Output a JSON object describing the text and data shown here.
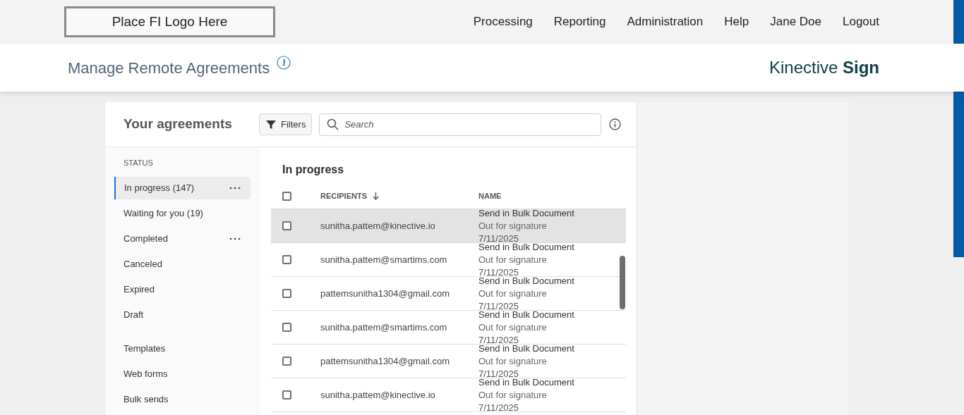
{
  "header": {
    "logo": "Place FI Logo Here",
    "nav": [
      "Processing",
      "Reporting",
      "Administration",
      "Help",
      "Jane Doe",
      "Logout"
    ]
  },
  "page": {
    "title": "Manage Remote Agreements",
    "brand_light": "Kinective",
    "brand_bold": "Sign"
  },
  "panel": {
    "title": "Your agreements",
    "filters_button": "Filters",
    "search": {
      "placeholder": "Search"
    }
  },
  "sidebar": {
    "section": "STATUS",
    "groups": [
      {
        "items": [
          {
            "label": "In progress (147)",
            "selected": true,
            "menu": true
          },
          {
            "label": "Waiting for you (19)",
            "selected": false,
            "menu": false
          },
          {
            "label": "Completed",
            "selected": false,
            "menu": true
          },
          {
            "label": "Canceled",
            "selected": false,
            "menu": false
          },
          {
            "label": "Expired",
            "selected": false,
            "menu": false
          },
          {
            "label": "Draft",
            "selected": false,
            "menu": false
          }
        ]
      },
      {
        "items": [
          {
            "label": "Templates",
            "selected": false,
            "menu": false
          },
          {
            "label": "Web forms",
            "selected": false,
            "menu": false
          },
          {
            "label": "Bulk sends",
            "selected": false,
            "menu": false
          }
        ]
      }
    ]
  },
  "list": {
    "title": "In progress",
    "select_all_checked": false,
    "columns": [
      "RECIPIENTS",
      "NAME"
    ],
    "rows": [
      {
        "recipient": "sunitha.pattem@kinective.io",
        "name": "Send in Bulk Document",
        "status": "Out for signature",
        "date": "7/11/2025",
        "checked": false,
        "highlighted": true
      },
      {
        "recipient": "sunitha.pattem@smartims.com",
        "name": "Send in Bulk Document",
        "status": "Out for signature",
        "date": "7/11/2025",
        "checked": false,
        "highlighted": false
      },
      {
        "recipient": "pattemsunitha1304@gmail.com",
        "name": "Send in Bulk Document",
        "status": "Out for signature",
        "date": "7/11/2025",
        "checked": false,
        "highlighted": false
      },
      {
        "recipient": "sunitha.pattem@smartims.com",
        "name": "Send in Bulk Document",
        "status": "Out for signature",
        "date": "7/11/2025",
        "checked": false,
        "highlighted": false
      },
      {
        "recipient": "pattemsunitha1304@gmail.com",
        "name": "Send in Bulk Document",
        "status": "Out for signature",
        "date": "7/11/2025",
        "checked": false,
        "highlighted": false
      },
      {
        "recipient": "sunitha.pattem@kinective.io",
        "name": "Send in Bulk Document",
        "status": "Out for signature",
        "date": "7/11/2025",
        "checked": false,
        "highlighted": false
      }
    ]
  }
}
